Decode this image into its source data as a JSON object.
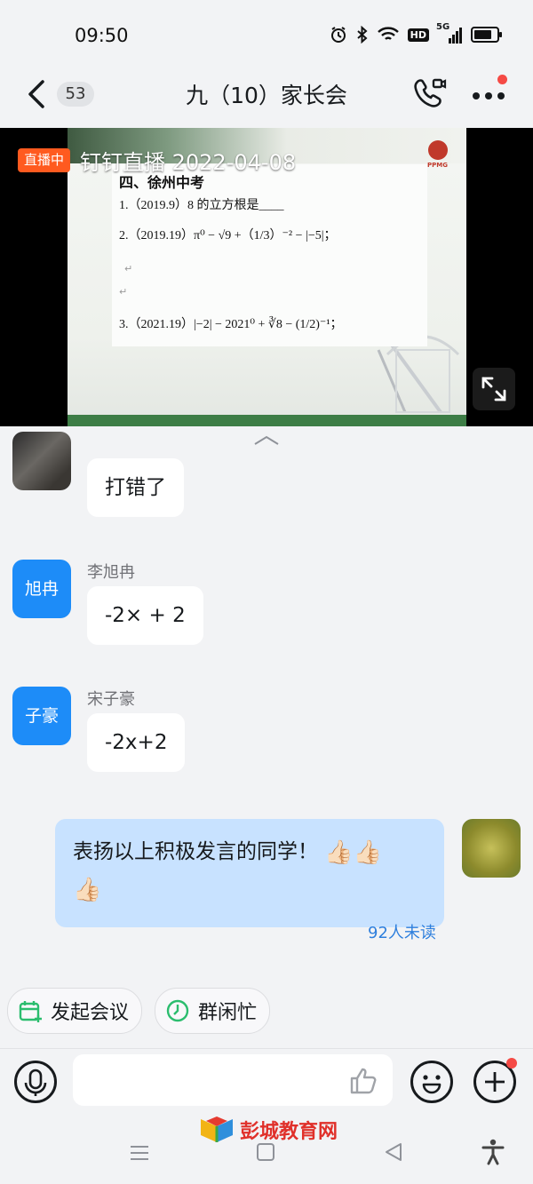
{
  "status_bar": {
    "time": "09:50",
    "network_badge": "HD",
    "signal_label": "5G"
  },
  "header": {
    "unread_count": "53",
    "title": "九（10）家长会"
  },
  "live": {
    "badge": "直播中",
    "title": "钉钉直播 2022-04-08",
    "slide": {
      "heading": "四、徐州中考",
      "q1": "1.（2019.9）8 的立方根是____",
      "q2": "2.（2019.19）π⁰ − √9 +（1/3）⁻² − |−5|；",
      "q3": "3.（2021.19）|−2| − 2021⁰ + ∛8 − (1/2)⁻¹；",
      "return_mark": "↵",
      "brand": "PPMG"
    }
  },
  "messages": [
    {
      "sender": "",
      "text": "打错了",
      "avatar_text": ""
    },
    {
      "sender": "李旭冉",
      "text": "-2× + 2",
      "avatar_text": "旭冉"
    },
    {
      "sender": "宋子豪",
      "text": "-2x+2",
      "avatar_text": "子豪"
    }
  ],
  "self_message": {
    "text": "表扬以上积极发言的同学！",
    "emoji": "👍🏻",
    "read_status": "92人未读"
  },
  "quick_actions": [
    {
      "label": "发起会议",
      "icon": "calendar-add-icon"
    },
    {
      "label": "群闲忙",
      "icon": "clock-icon"
    }
  ],
  "input": {
    "placeholder": ""
  },
  "watermark": {
    "text": "彭城教育网"
  },
  "colors": {
    "accent": "#1d8cf8",
    "self_bubble": "#c8e2ff",
    "live_badge": "#ff5a1f",
    "notify_dot": "#f54a45",
    "meeting_icon": "#2bbd6e"
  }
}
